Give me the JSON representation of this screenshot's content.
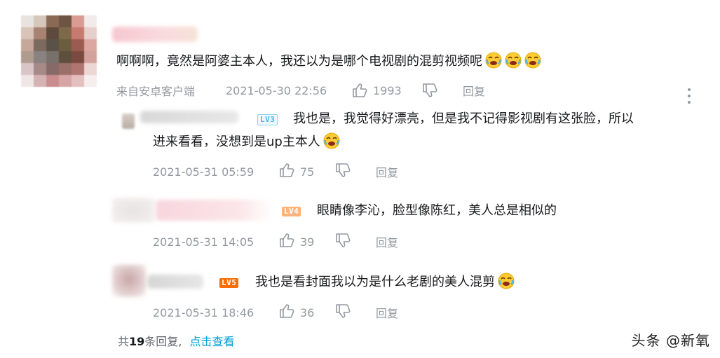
{
  "main_comment": {
    "text": "啊啊啊，竟然是阿婆主本人，我还以为是哪个电视剧的混剪视频呢",
    "emoji_count": 3,
    "source": "来自安卓客户端",
    "time": "2021-05-30 22:56",
    "likes": "1993",
    "reply": "回复"
  },
  "replies": [
    {
      "level": "LV3",
      "text_line1": "我也是，我觉得好漂亮，但是我不记得影视剧有这张脸，所以",
      "text_line2": "进来看看，没想到是up主本人",
      "time": "2021-05-31 05:59",
      "likes": "75",
      "reply": "回复"
    },
    {
      "level": "LV4",
      "text": "眼睛像李沁，脸型像陈红，美人总是相似的",
      "time": "2021-05-31 14:05",
      "likes": "39",
      "reply": "回复"
    },
    {
      "level": "LV5",
      "text": "我也是看封面我以为是什么老剧的美人混剪",
      "time": "2021-05-31 18:46",
      "likes": "36",
      "reply": "回复"
    }
  ],
  "footer": {
    "prefix": "共",
    "count": "19",
    "suffix": "条回复,",
    "link": "点击查看"
  },
  "watermark": "头条 @新氧",
  "colors": {
    "meta_gray": "#9499a0",
    "link_blue": "#00a1d6",
    "lv3": "#4fb6dc",
    "lv4": "#ffb27a",
    "lv5": "#ff6c00"
  }
}
